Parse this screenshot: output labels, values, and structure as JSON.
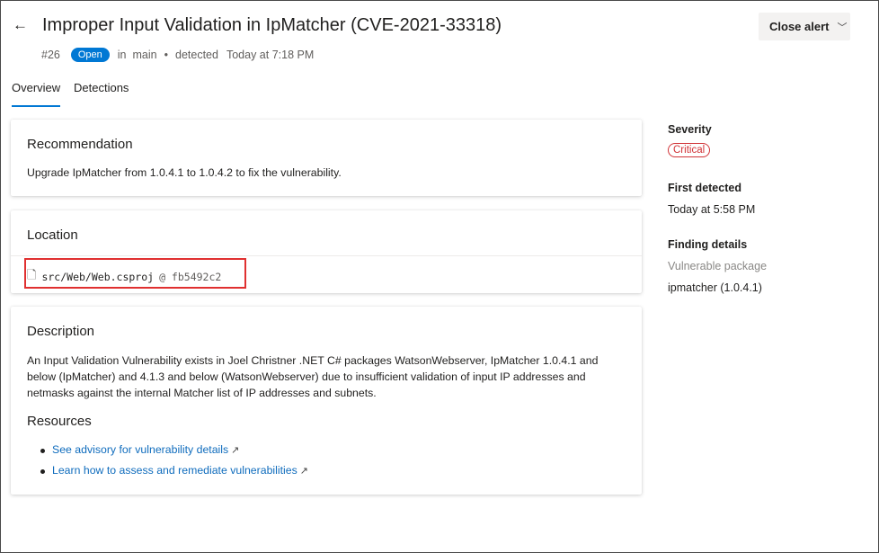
{
  "header": {
    "title": "Improper Input Validation in IpMatcher (CVE-2021-33318)",
    "close_label": "Close alert",
    "alert_number": "#26",
    "status": "Open",
    "in_label": "in",
    "branch": "main",
    "bullet": "•",
    "detected_label": "detected",
    "detected_time": "Today at 7:18 PM"
  },
  "tabs": [
    {
      "label": "Overview",
      "active": true
    },
    {
      "label": "Detections",
      "active": false
    }
  ],
  "recommendation": {
    "heading": "Recommendation",
    "text": "Upgrade IpMatcher from 1.0.4.1 to 1.0.4.2 to fix the vulnerability."
  },
  "location": {
    "heading": "Location",
    "path": "src/Web/Web.csproj",
    "commit": "@ fb5492c2"
  },
  "description": {
    "heading": "Description",
    "text": "An Input Validation Vulnerability exists in Joel Christner .NET C# packages WatsonWebserver, IpMatcher 1.0.4.1 and below (IpMatcher) and 4.1.3 and below (WatsonWebserver) due to insufficient validation of input IP addresses and netmasks against the internal Matcher list of IP addresses and subnets.",
    "resources_heading": "Resources",
    "links": [
      {
        "label": "See advisory for vulnerability details"
      },
      {
        "label": "Learn how to assess and remediate vulnerabilities"
      }
    ]
  },
  "sidebar": {
    "severity_label": "Severity",
    "severity_value": "Critical",
    "first_detected_label": "First detected",
    "first_detected_value": "Today at 5:58 PM",
    "finding_details_label": "Finding details",
    "vulnerable_package_label": "Vulnerable package",
    "vulnerable_package_value": "ipmatcher (1.0.4.1)"
  },
  "colors": {
    "accent": "#0078d4",
    "critical": "#d13438",
    "highlight_box": "#e03030"
  }
}
